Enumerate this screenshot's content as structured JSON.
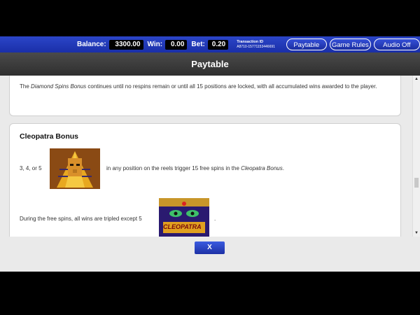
{
  "topbar": {
    "balance_label": "Balance:",
    "balance_value": "3300.00",
    "win_label": "Win:",
    "win_value": "0.00",
    "bet_label": "Bet:",
    "bet_value": "0.20",
    "txid_label": "Transaction ID",
    "txid_value": "A8710-15771153446691",
    "paytable_button": "Paytable",
    "rules_button": "Game Rules",
    "audio_button": "Audio Off"
  },
  "header": {
    "title": "Paytable"
  },
  "content": {
    "diamond_text_italic": "Diamond Spins Bonus",
    "diamond_text_pre": "The ",
    "diamond_text_post": " continues until no respins remain or until all 15 positions are locked, with all accumulated wins awarded to the player.",
    "cleo_title": "Cleopatra Bonus",
    "trigger_count": "3, 4, or 5",
    "trigger_text_pre": "in any position on the reels trigger 15 free spins in the ",
    "trigger_text_italic": "Cleopatra Bonus",
    "trigger_text_post": ".",
    "triple_text": "During the free spins, all wins are tripled except 5",
    "triple_text_after": ".",
    "cleopatra_logo_text": "CLEOPATRA"
  },
  "footer": {
    "close_label": "X"
  },
  "colors": {
    "accent": "#1d31a5",
    "header": "#3a3a3a"
  }
}
